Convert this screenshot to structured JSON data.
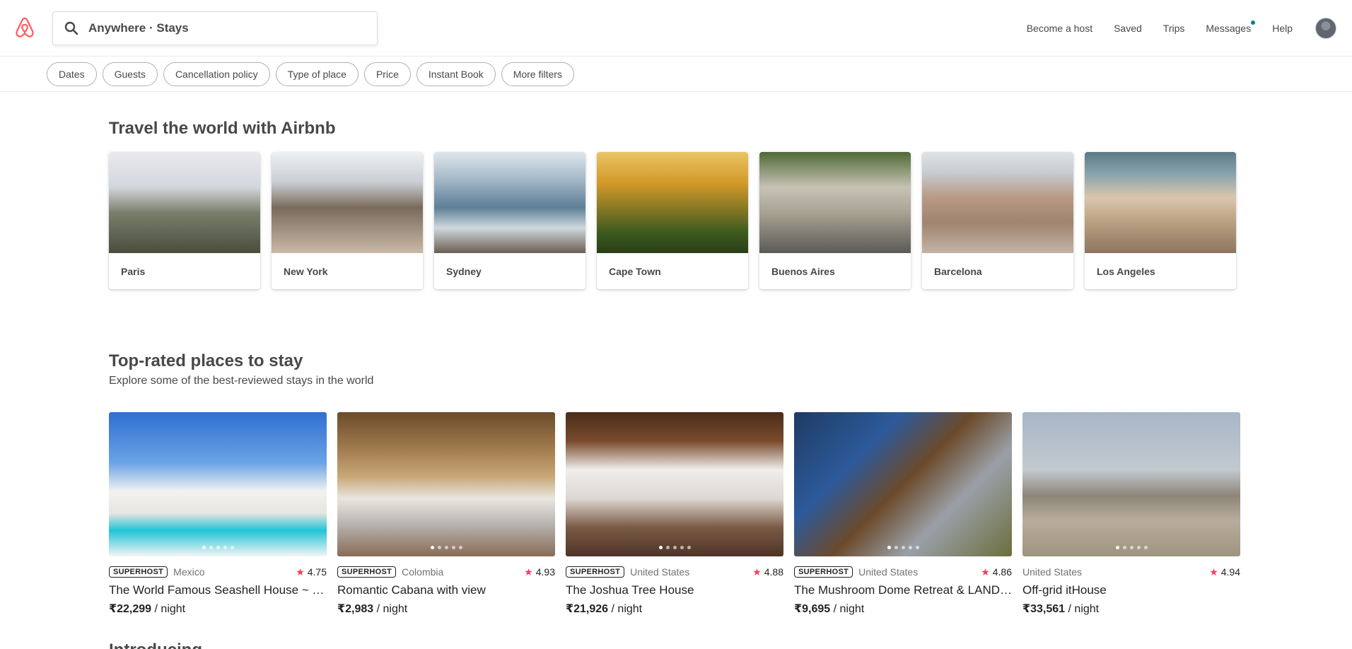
{
  "header": {
    "search_text": "Anywhere · Stays",
    "nav": [
      "Become a host",
      "Saved",
      "Trips",
      "Messages",
      "Help"
    ],
    "brand_color": "#FF5A5F"
  },
  "filters": [
    "Dates",
    "Guests",
    "Cancellation policy",
    "Type of place",
    "Price",
    "Instant Book",
    "More filters"
  ],
  "travel": {
    "title": "Travel the world with Airbnb",
    "cities": [
      "Paris",
      "New York",
      "Sydney",
      "Cape Town",
      "Buenos Aires",
      "Barcelona",
      "Los Angeles"
    ]
  },
  "top_rated": {
    "title": "Top-rated places to stay",
    "subtitle": "Explore some of the best-reviewed stays in the world",
    "badge_label": "SUPERHOST",
    "night_suffix": " / night",
    "listings": [
      {
        "superhost": true,
        "country": "Mexico",
        "rating": "4.75",
        "title": "The World Famous Seashell House ~ Cas...",
        "price": "₹22,299"
      },
      {
        "superhost": true,
        "country": "Colombia",
        "rating": "4.93",
        "title": "Romantic Cabana with view",
        "price": "₹2,983"
      },
      {
        "superhost": true,
        "country": "United States",
        "rating": "4.88",
        "title": "The Joshua Tree House",
        "price": "₹21,926"
      },
      {
        "superhost": true,
        "country": "United States",
        "rating": "4.86",
        "title": "The Mushroom Dome Retreat & LAND o...",
        "price": "₹9,695"
      },
      {
        "superhost": false,
        "country": "United States",
        "rating": "4.94",
        "title": "Off-grid itHouse",
        "price": "₹33,561"
      }
    ]
  },
  "next_section_title": "Introducing"
}
